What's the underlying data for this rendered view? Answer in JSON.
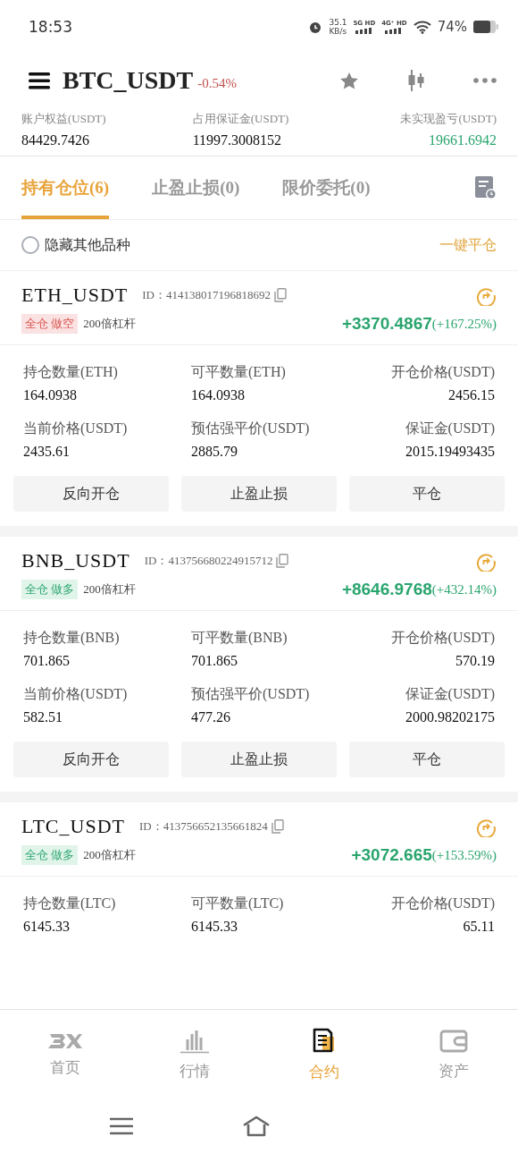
{
  "status_bar": {
    "time": "18:53",
    "speed": "35.1",
    "speed_unit": "KB/s",
    "sim1": "5G HD",
    "sim2": "4G⁺ HD",
    "battery": "74%"
  },
  "header": {
    "symbol": "BTC_USDT",
    "change": "-0.54%"
  },
  "summary": [
    {
      "label": "账户权益(USDT)",
      "value": "84429.7426",
      "color": "#111111"
    },
    {
      "label": "占用保证金(USDT)",
      "value": "11997.3008152",
      "color": "#111111"
    },
    {
      "label": "未实现盈亏(USDT)",
      "value": "19661.6942",
      "color": "#2aa56e"
    }
  ],
  "tabs": [
    {
      "label": "持有仓位(6)",
      "selected": true
    },
    {
      "label": "止盈止损(0)",
      "selected": false
    },
    {
      "label": "限价委托(0)",
      "selected": false
    }
  ],
  "filter": {
    "label": "隐藏其他品种",
    "checked": false,
    "action": "一键平仓"
  },
  "positions": [
    {
      "symbol": "ETH_USDT",
      "id": "ID：414138017196818692",
      "kind": "short",
      "tag": "全仓 做空",
      "leverage": "200倍杠杆",
      "pnl": "+3370.4867",
      "pnl_pct": "(+167.25%)",
      "stats": [
        {
          "label": "持仓数量(ETH)",
          "value": "164.0938"
        },
        {
          "label": "可平数量(ETH)",
          "value": "164.0938"
        },
        {
          "label": "开仓价格(USDT)",
          "value": "2456.15"
        },
        {
          "label": "当前价格(USDT)",
          "value": "2435.61"
        },
        {
          "label": "预估强平价(USDT)",
          "value": "2885.79"
        },
        {
          "label": "保证金(USDT)",
          "value": "2015.19493435"
        }
      ],
      "buttons": [
        "反向开仓",
        "止盈止损",
        "平仓"
      ]
    },
    {
      "symbol": "BNB_USDT",
      "id": "ID：413756680224915712",
      "kind": "long",
      "tag": "全仓 做多",
      "leverage": "200倍杠杆",
      "pnl": "+8646.9768",
      "pnl_pct": "(+432.14%)",
      "stats": [
        {
          "label": "持仓数量(BNB)",
          "value": "701.865"
        },
        {
          "label": "可平数量(BNB)",
          "value": "701.865"
        },
        {
          "label": "开仓价格(USDT)",
          "value": "570.19"
        },
        {
          "label": "当前价格(USDT)",
          "value": "582.51"
        },
        {
          "label": "预估强平价(USDT)",
          "value": "477.26"
        },
        {
          "label": "保证金(USDT)",
          "value": "2000.98202175"
        }
      ],
      "buttons": [
        "反向开仓",
        "止盈止损",
        "平仓"
      ]
    },
    {
      "symbol": "LTC_USDT",
      "id": "ID：413756652135661824",
      "kind": "long",
      "tag": "全仓 做多",
      "leverage": "200倍杠杆",
      "pnl": "+3072.665",
      "pnl_pct": "(+153.59%)",
      "stats": [
        {
          "label": "持仓数量(LTC)",
          "value": "6145.33"
        },
        {
          "label": "可平数量(LTC)",
          "value": "6145.33"
        },
        {
          "label": "开仓价格(USDT)",
          "value": "65.11"
        }
      ]
    }
  ],
  "bottom_nav": [
    {
      "label": "首页",
      "kind": "home",
      "selected": false
    },
    {
      "label": "行情",
      "kind": "market",
      "selected": false
    },
    {
      "label": "合约",
      "kind": "contract",
      "selected": true
    },
    {
      "label": "资产",
      "kind": "assets",
      "selected": false
    }
  ]
}
